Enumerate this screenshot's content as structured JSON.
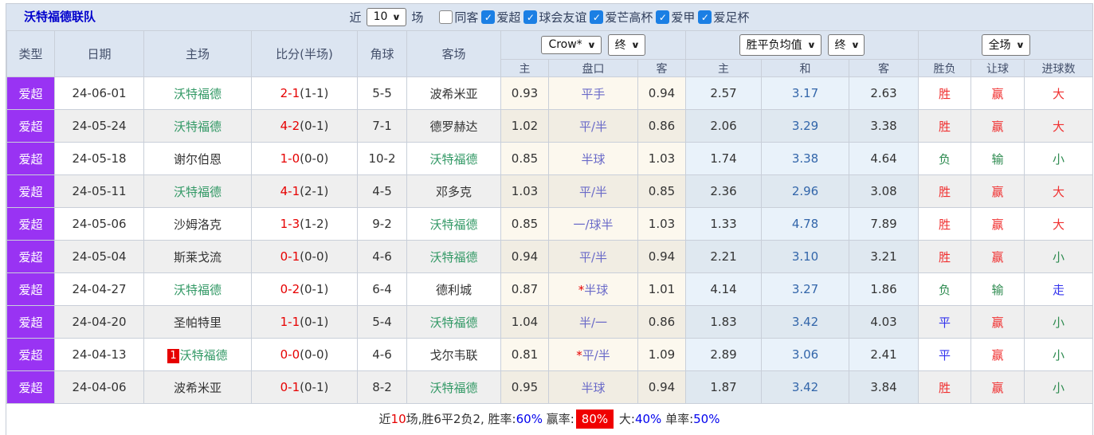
{
  "topbar": {
    "title": "沃特福德联队",
    "near_label": "近",
    "match_count": "10",
    "games_label": "场",
    "filters": [
      {
        "label": "同客",
        "checked": false
      },
      {
        "label": "爱超",
        "checked": true
      },
      {
        "label": "球会友谊",
        "checked": true
      },
      {
        "label": "爱芒高杯",
        "checked": true
      },
      {
        "label": "爱甲",
        "checked": true
      },
      {
        "label": "爱足杯",
        "checked": true
      }
    ]
  },
  "colors": {
    "league_badge": "#9933f3",
    "win_red": "#f03030",
    "lose_green": "#2e8b50",
    "draw_blue": "#3333ee",
    "team_green": "#339966",
    "score_red": "#e60000",
    "header_bg": "#dce5f1"
  },
  "table": {
    "main_headers": [
      "类型",
      "日期",
      "主场",
      "比分(半场)",
      "角球",
      "客场"
    ],
    "selects": {
      "company": "Crow*",
      "company_time": "终",
      "avg": "胜平负均值",
      "avg_time": "终",
      "period": "全场"
    },
    "sub_headers": [
      "主",
      "盘口",
      "客",
      "主",
      "和",
      "客",
      "胜负",
      "让球",
      "进球数"
    ],
    "rows": [
      {
        "league": "爱超",
        "date": "24-06-01",
        "home": "沃特福德",
        "home_green": true,
        "home_badge": "",
        "ft": "2-1",
        "ht": "(1-1)",
        "corner": "5-5",
        "away": "波希米亚",
        "away_green": false,
        "odds_home": "0.93",
        "handicap": "平手",
        "star": false,
        "odds_away": "0.94",
        "avg_home": "2.57",
        "avg_draw": "3.17",
        "avg_away": "2.63",
        "res": [
          [
            "胜",
            "red"
          ],
          [
            "赢",
            "red"
          ],
          [
            "大",
            "red"
          ]
        ]
      },
      {
        "league": "爱超",
        "date": "24-05-24",
        "home": "沃特福德",
        "home_green": true,
        "home_badge": "",
        "ft": "4-2",
        "ht": "(0-1)",
        "corner": "7-1",
        "away": "德罗赫达",
        "away_green": false,
        "odds_home": "1.02",
        "handicap": "平/半",
        "star": false,
        "odds_away": "0.86",
        "avg_home": "2.06",
        "avg_draw": "3.29",
        "avg_away": "3.38",
        "res": [
          [
            "胜",
            "red"
          ],
          [
            "赢",
            "red"
          ],
          [
            "大",
            "red"
          ]
        ]
      },
      {
        "league": "爱超",
        "date": "24-05-18",
        "home": "谢尔伯恩",
        "home_green": false,
        "home_badge": "",
        "ft": "1-0",
        "ht": "(0-0)",
        "corner": "10-2",
        "away": "沃特福德",
        "away_green": true,
        "odds_home": "0.85",
        "handicap": "半球",
        "star": false,
        "odds_away": "1.03",
        "avg_home": "1.74",
        "avg_draw": "3.38",
        "avg_away": "4.64",
        "res": [
          [
            "负",
            "green"
          ],
          [
            "输",
            "green"
          ],
          [
            "小",
            "green"
          ]
        ]
      },
      {
        "league": "爱超",
        "date": "24-05-11",
        "home": "沃特福德",
        "home_green": true,
        "home_badge": "",
        "ft": "4-1",
        "ht": "(2-1)",
        "corner": "4-5",
        "away": "邓多克",
        "away_green": false,
        "odds_home": "1.03",
        "handicap": "平/半",
        "star": false,
        "odds_away": "0.85",
        "avg_home": "2.36",
        "avg_draw": "2.96",
        "avg_away": "3.08",
        "res": [
          [
            "胜",
            "red"
          ],
          [
            "赢",
            "red"
          ],
          [
            "大",
            "red"
          ]
        ]
      },
      {
        "league": "爱超",
        "date": "24-05-06",
        "home": "沙姆洛克",
        "home_green": false,
        "home_badge": "",
        "ft": "1-3",
        "ht": "(1-2)",
        "corner": "9-2",
        "away": "沃特福德",
        "away_green": true,
        "odds_home": "0.85",
        "handicap": "一/球半",
        "star": false,
        "odds_away": "1.03",
        "avg_home": "1.33",
        "avg_draw": "4.78",
        "avg_away": "7.89",
        "res": [
          [
            "胜",
            "red"
          ],
          [
            "赢",
            "red"
          ],
          [
            "大",
            "red"
          ]
        ]
      },
      {
        "league": "爱超",
        "date": "24-05-04",
        "home": "斯莱戈流",
        "home_green": false,
        "home_badge": "",
        "ft": "0-1",
        "ht": "(0-0)",
        "corner": "4-6",
        "away": "沃特福德",
        "away_green": true,
        "odds_home": "0.94",
        "handicap": "平/半",
        "star": false,
        "odds_away": "0.94",
        "avg_home": "2.21",
        "avg_draw": "3.10",
        "avg_away": "3.21",
        "res": [
          [
            "胜",
            "red"
          ],
          [
            "赢",
            "red"
          ],
          [
            "小",
            "green"
          ]
        ]
      },
      {
        "league": "爱超",
        "date": "24-04-27",
        "home": "沃特福德",
        "home_green": true,
        "home_badge": "",
        "ft": "0-2",
        "ht": "(0-1)",
        "corner": "6-4",
        "away": "德利城",
        "away_green": false,
        "odds_home": "0.87",
        "handicap": "半球",
        "star": true,
        "odds_away": "1.01",
        "avg_home": "4.14",
        "avg_draw": "3.27",
        "avg_away": "1.86",
        "res": [
          [
            "负",
            "green"
          ],
          [
            "输",
            "green"
          ],
          [
            "走",
            "blue"
          ]
        ]
      },
      {
        "league": "爱超",
        "date": "24-04-20",
        "home": "圣帕特里",
        "home_green": false,
        "home_badge": "",
        "ft": "1-1",
        "ht": "(0-1)",
        "corner": "5-4",
        "away": "沃特福德",
        "away_green": true,
        "odds_home": "1.04",
        "handicap": "半/一",
        "star": false,
        "odds_away": "0.86",
        "avg_home": "1.83",
        "avg_draw": "3.42",
        "avg_away": "4.03",
        "res": [
          [
            "平",
            "blue"
          ],
          [
            "赢",
            "red"
          ],
          [
            "小",
            "green"
          ]
        ]
      },
      {
        "league": "爱超",
        "date": "24-04-13",
        "home": "沃特福德",
        "home_green": true,
        "home_badge": "1",
        "ft": "0-0",
        "ht": "(0-0)",
        "corner": "4-6",
        "away": "戈尔韦联",
        "away_green": false,
        "odds_home": "0.81",
        "handicap": "平/半",
        "star": true,
        "odds_away": "1.09",
        "avg_home": "2.89",
        "avg_draw": "3.06",
        "avg_away": "2.41",
        "res": [
          [
            "平",
            "blue"
          ],
          [
            "赢",
            "red"
          ],
          [
            "小",
            "green"
          ]
        ]
      },
      {
        "league": "爱超",
        "date": "24-04-06",
        "home": "波希米亚",
        "home_green": false,
        "home_badge": "",
        "ft": "0-1",
        "ht": "(0-1)",
        "corner": "8-2",
        "away": "沃特福德",
        "away_green": true,
        "odds_home": "0.95",
        "handicap": "半球",
        "star": false,
        "odds_away": "0.94",
        "avg_home": "1.87",
        "avg_draw": "3.42",
        "avg_away": "3.84",
        "res": [
          [
            "胜",
            "red"
          ],
          [
            "赢",
            "red"
          ],
          [
            "小",
            "green"
          ]
        ]
      }
    ]
  },
  "footer": {
    "segments": [
      [
        "近",
        "dark"
      ],
      [
        "10",
        "red"
      ],
      [
        "场,胜6平2负2, 胜率:",
        "dark"
      ],
      [
        "60%",
        "blue"
      ],
      [
        " 赢率:",
        "dark"
      ],
      [
        "80%",
        "badge"
      ],
      [
        " 大:",
        "dark"
      ],
      [
        "40%",
        "blue"
      ],
      [
        " 单率:",
        "dark"
      ],
      [
        "50%",
        "blue"
      ]
    ]
  }
}
